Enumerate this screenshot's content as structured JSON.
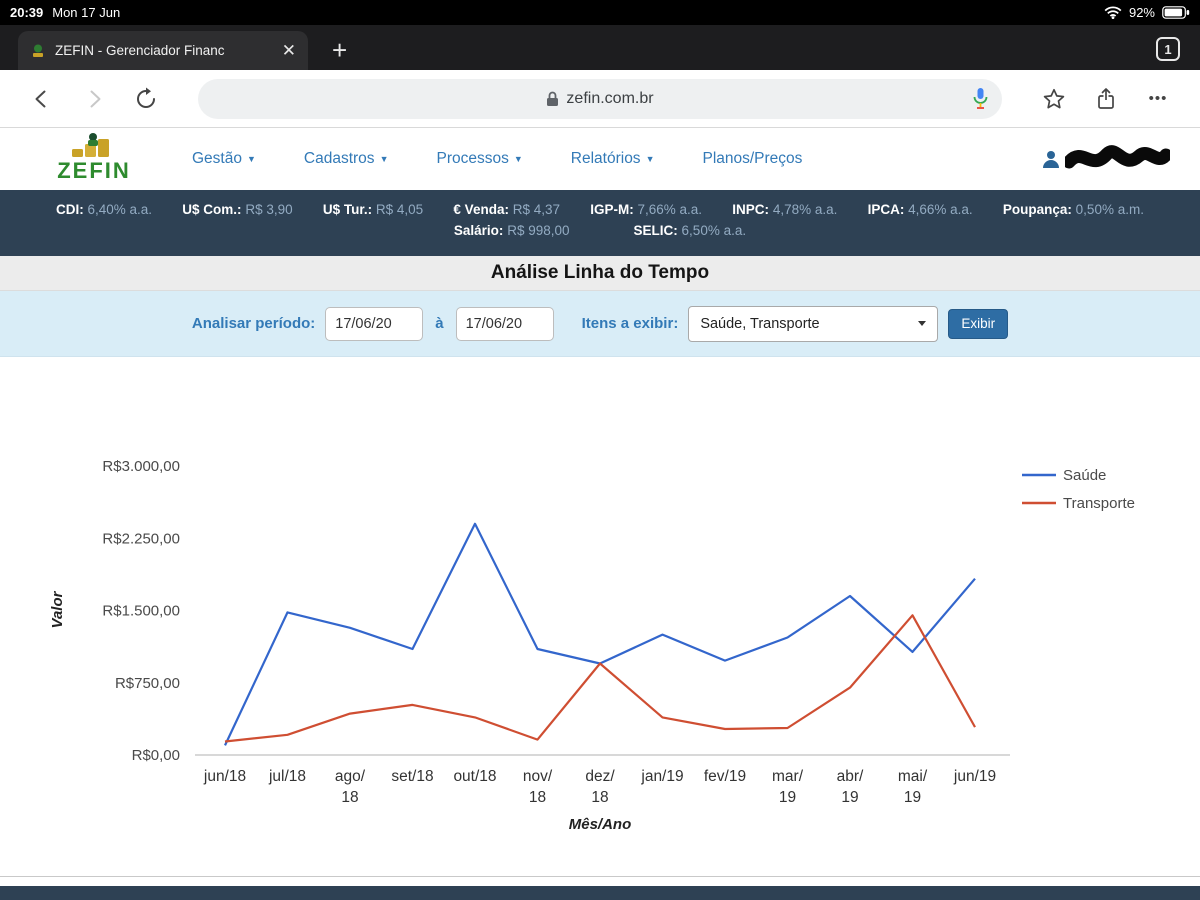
{
  "status_bar": {
    "time": "20:39",
    "date": "Mon 17 Jun",
    "battery": "92%"
  },
  "browser": {
    "tab_title": "ZEFIN - Gerenciador Financ",
    "close_tab": "✕",
    "new_tab": "+",
    "tab_count": "1",
    "url": "zefin.com.br",
    "menu_dots": "•••"
  },
  "site_header": {
    "logo_text": "ZEFIN",
    "nav": [
      {
        "label": "Gestão"
      },
      {
        "label": "Cadastros"
      },
      {
        "label": "Processos"
      },
      {
        "label": "Relatórios"
      },
      {
        "label": "Planos/Preços"
      }
    ]
  },
  "indicators": {
    "row1": [
      {
        "label": "CDI:",
        "value": "6,40% a.a."
      },
      {
        "label": "U$ Com.:",
        "value": "R$ 3,90"
      },
      {
        "label": "U$ Tur.:",
        "value": "R$ 4,05"
      },
      {
        "label": "€ Venda:",
        "value": "R$ 4,37"
      },
      {
        "label": "IGP-M:",
        "value": "7,66% a.a."
      },
      {
        "label": "INPC:",
        "value": "4,78% a.a."
      },
      {
        "label": "IPCA:",
        "value": "4,66% a.a."
      },
      {
        "label": "Poupança:",
        "value": "0,50% a.m."
      }
    ],
    "row2": [
      {
        "label": "Salário:",
        "value": "R$ 998,00"
      },
      {
        "label": "SELIC:",
        "value": "6,50% a.a."
      }
    ]
  },
  "page": {
    "title": "Análise Linha do Tempo"
  },
  "filters": {
    "period_label": "Analisar período:",
    "date_from": "17/06/20",
    "date_to": "17/06/20",
    "separator": "à",
    "items_label": "Itens a exibir:",
    "items_value": "Saúde, Transporte",
    "submit_label": "Exibir"
  },
  "chart_data": {
    "type": "line",
    "title": "",
    "xlabel": "Mês/Ano",
    "ylabel": "Valor",
    "categories": [
      "jun/18",
      "jul/18",
      "ago/18",
      "set/18",
      "out/18",
      "nov/18",
      "dez/18",
      "jan/19",
      "fev/19",
      "mar/19",
      "abr/19",
      "mai/19",
      "jun/19"
    ],
    "x_labels_display": [
      "jun/18",
      "jul/18",
      "ago/\n18",
      "set/18",
      "out/18",
      "nov/\n18",
      "dez/\n18",
      "jan/19",
      "fev/19",
      "mar/\n19",
      "abr/\n19",
      "mai/\n19",
      "jun/19"
    ],
    "ylim": [
      0,
      3000
    ],
    "y_ticks": [
      {
        "label": "R$0,00",
        "value": 0
      },
      {
        "label": "R$750,00",
        "value": 750
      },
      {
        "label": "R$1.500,00",
        "value": 1500
      },
      {
        "label": "R$2.250,00",
        "value": 2250
      },
      {
        "label": "R$3.000,00",
        "value": 3000
      }
    ],
    "grid": false,
    "legend_position": "right",
    "series": [
      {
        "name": "Saúde",
        "color": "#3366cc",
        "values": [
          100,
          1480,
          1320,
          1100,
          2400,
          1100,
          950,
          1250,
          980,
          1220,
          1650,
          1070,
          1830
        ]
      },
      {
        "name": "Transporte",
        "color": "#cf4e32",
        "values": [
          140,
          210,
          430,
          520,
          390,
          160,
          950,
          390,
          270,
          280,
          700,
          1450,
          290
        ]
      }
    ]
  }
}
